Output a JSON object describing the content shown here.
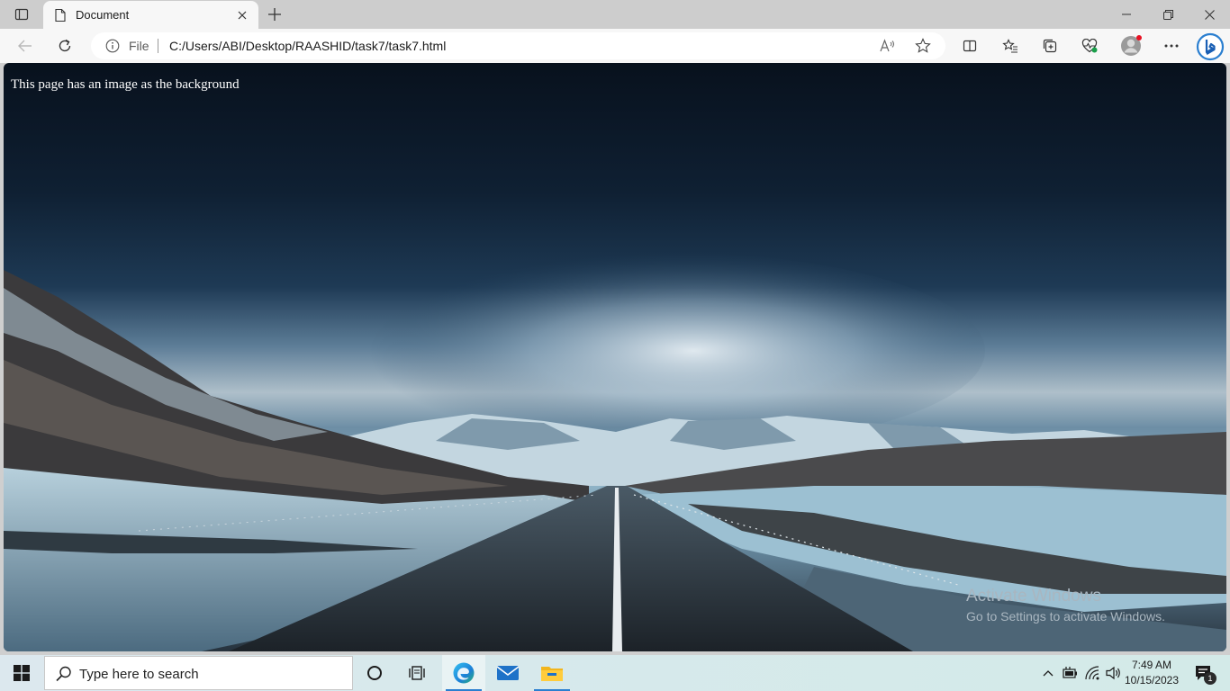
{
  "tab": {
    "title": "Document"
  },
  "address_bar": {
    "scheme_label": "File",
    "url": "C:/Users/ABI/Desktop/RAASHID/task7/task7.html"
  },
  "page": {
    "text": "This page has an image as the background",
    "background_scene": "road-through-snowy-mountains"
  },
  "watermark": {
    "title": "Activate Windows",
    "subtitle": "Go to Settings to activate Windows."
  },
  "taskbar": {
    "search_placeholder": "Type here to search",
    "time": "7:49 AM",
    "date": "10/15/2023",
    "notification_count": "1",
    "apps": [
      "cortana-icon",
      "task-view-icon",
      "edge-icon",
      "mail-icon",
      "file-explorer-icon"
    ]
  },
  "colors": {
    "accent": "#2b7fd0",
    "tab_active": "#f7f7f7",
    "tabstrip": "#cdcdcd"
  }
}
